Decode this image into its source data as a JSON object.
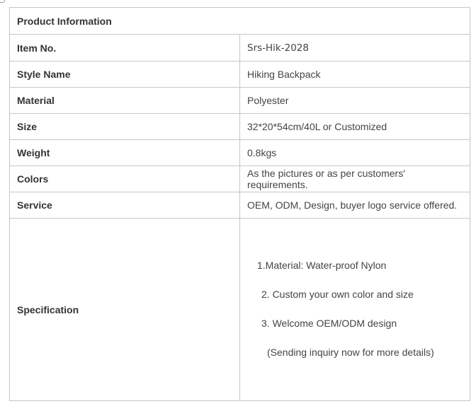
{
  "table": {
    "header": "Product Information",
    "rows": [
      {
        "label": "Item No.",
        "value": "Srs-Hik-2028"
      },
      {
        "label": "Style Name",
        "value": "Hiking Backpack"
      },
      {
        "label": "Material",
        "value": "Polyester"
      },
      {
        "label": "Size",
        "value": "32*20*54cm/40L or Customized"
      },
      {
        "label": "Weight",
        "value": "0.8kgs"
      },
      {
        "label": "Colors",
        "value": "As the pictures or as per customers' requirements."
      },
      {
        "label": "Service",
        "value": "OEM, ODM, Design, buyer logo service offered."
      }
    ],
    "specification": {
      "label": "Specification",
      "lines": [
        "1.Material:  Water-proof Nylon",
        "2. Custom your own color and size",
        "3. Welcome OEM/ODM design",
        "(Sending inquiry now for more details)"
      ]
    }
  }
}
